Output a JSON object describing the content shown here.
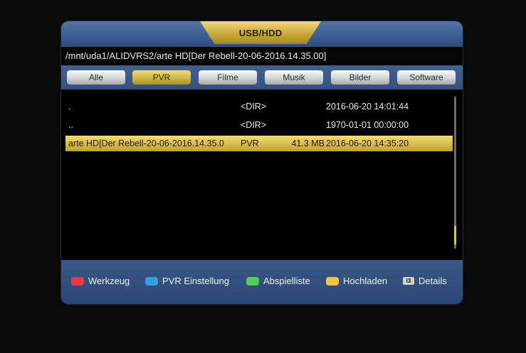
{
  "window": {
    "title": "USB/HDD"
  },
  "path": "/mnt/uda1/ALIDVRS2/arte HD[Der Rebell-20-06-2016.14.35.00]",
  "tabs": [
    {
      "label": "Alle"
    },
    {
      "label": "PVR",
      "active": true
    },
    {
      "label": "Filme"
    },
    {
      "label": "Musik"
    },
    {
      "label": "Bilder"
    },
    {
      "label": "Software"
    }
  ],
  "files": [
    {
      "name": ".",
      "type": "<DIR>",
      "size": "",
      "date": "2016-06-20 14:01:44",
      "selected": false
    },
    {
      "name": "..",
      "type": "<DIR>",
      "size": "",
      "date": "1970-01-01 00:00:00",
      "selected": false
    },
    {
      "name": "arte HD[Der Rebell-20-06-2016.14.35.0",
      "type": "PVR",
      "size": "41.3 MB",
      "date": "2016-06-20 14:35:20",
      "selected": true
    }
  ],
  "scrollbar": {
    "position_fraction": 0.97,
    "thumb_fraction": 0.12
  },
  "footer": {
    "items": [
      {
        "key": "red-key",
        "color": "#e23b4a",
        "label": "Werkzeug"
      },
      {
        "key": "blue-key",
        "color": "#3b9be0",
        "label": "PVR Einstellung"
      },
      {
        "key": "green-key",
        "color": "#4fcf57",
        "label": "Abspielliste"
      },
      {
        "key": "yellow-key",
        "color": "#f0c34a",
        "label": "Hochladen"
      },
      {
        "key": "info-key",
        "color": "#cfcfcf",
        "icon_text": "i3",
        "label": "Details"
      }
    ]
  }
}
